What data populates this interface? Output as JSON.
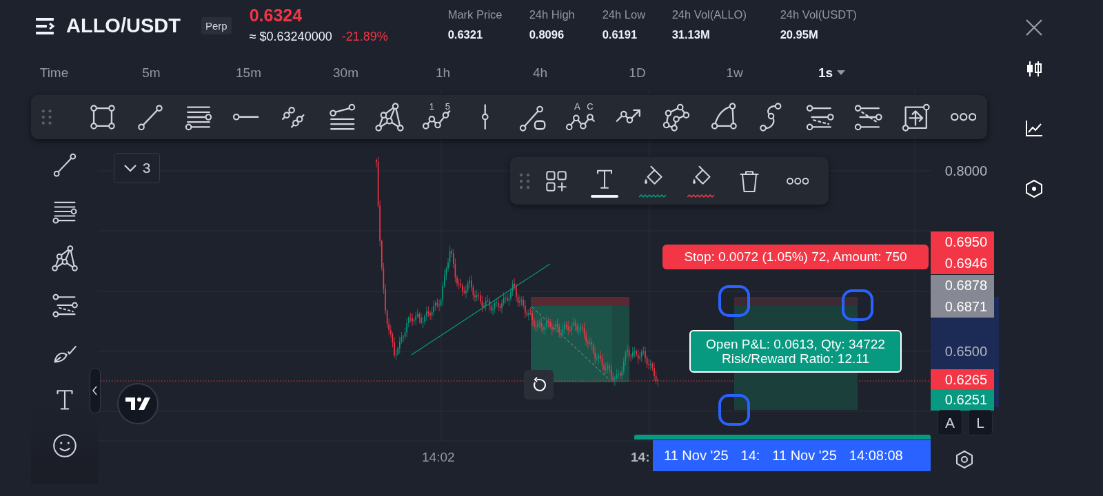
{
  "header": {
    "symbol": "ALLO/USDT",
    "badge": "Perp",
    "last_price": "0.6324",
    "approx_price": "≈ $0.63240000",
    "change": "-21.89%",
    "stats": [
      {
        "label": "Mark Price",
        "value": "0.6321"
      },
      {
        "label": "24h High",
        "value": "0.8096"
      },
      {
        "label": "24h Low",
        "value": "0.6191"
      },
      {
        "label": "24h Vol(ALLO)",
        "value": "31.13M"
      },
      {
        "label": "24h Vol(USDT)",
        "value": "20.95M"
      }
    ]
  },
  "timeframes": [
    {
      "label": "Time",
      "selected": false
    },
    {
      "label": "5m",
      "selected": false
    },
    {
      "label": "15m",
      "selected": false
    },
    {
      "label": "30m",
      "selected": false
    },
    {
      "label": "1h",
      "selected": false
    },
    {
      "label": "4h",
      "selected": false
    },
    {
      "label": "1D",
      "selected": false
    },
    {
      "label": "1w",
      "selected": false
    },
    {
      "label": "1s",
      "selected": true
    }
  ],
  "drawing_tools": [
    {
      "kind": "rectangle"
    },
    {
      "kind": "trend_line"
    },
    {
      "kind": "horizontal_lines"
    },
    {
      "kind": "horizontal_ray"
    },
    {
      "kind": "parallel_channel"
    },
    {
      "kind": "fib_lines"
    },
    {
      "kind": "xabcd_pattern"
    },
    {
      "kind": "elliott_wave",
      "marks": [
        "1",
        "5"
      ]
    },
    {
      "kind": "vertical_line"
    },
    {
      "kind": "line_with_box"
    },
    {
      "kind": "abcd_pattern",
      "marks": [
        "A",
        "C"
      ]
    },
    {
      "kind": "arrow_line"
    },
    {
      "kind": "polygon"
    },
    {
      "kind": "arc"
    },
    {
      "kind": "curve"
    },
    {
      "kind": "fib_dashed"
    },
    {
      "kind": "fib_dashed_alt"
    },
    {
      "kind": "measure_box"
    },
    {
      "kind": "more"
    }
  ],
  "side_tools": [
    {
      "kind": "trend_line"
    },
    {
      "kind": "horizontal_lines"
    },
    {
      "kind": "xabcd_pattern"
    },
    {
      "kind": "fib_dashed"
    },
    {
      "kind": "brush"
    },
    {
      "kind": "text"
    },
    {
      "kind": "emoji"
    }
  ],
  "object_toolbar": [
    {
      "kind": "add",
      "selected": false
    },
    {
      "kind": "text",
      "selected": true
    },
    {
      "kind": "fill",
      "selected": false,
      "color": "#089981"
    },
    {
      "kind": "fill",
      "selected": false,
      "color": "#f23645"
    },
    {
      "kind": "delete",
      "selected": false
    },
    {
      "kind": "more",
      "selected": false
    }
  ],
  "chart": {
    "collapsed_count": "3",
    "price_axis": [
      {
        "text": "0.8000",
        "kind": "axis"
      },
      {
        "text": "0.6950",
        "kind": "red"
      },
      {
        "text": "0.6946",
        "kind": "red"
      },
      {
        "text": "0.6878",
        "kind": "grey"
      },
      {
        "text": "0.6871",
        "kind": "grey"
      },
      {
        "text": "0.6500",
        "kind": "axis"
      },
      {
        "text": "0.6265",
        "kind": "red"
      },
      {
        "text": "0.6251",
        "kind": "green"
      }
    ],
    "time_axis": [
      {
        "text": "14:02",
        "kind": "axis"
      },
      {
        "text": "14:",
        "kind": "bold"
      }
    ],
    "stop_label": "Stop: 0.0072 (1.05%) 72, Amount: 750",
    "pnl_label": [
      "Open P&L: 0.0613, Qty: 34722",
      "Risk/Reward Ratio: 12.11"
    ],
    "crosshair_labels": [
      "11 Nov '25",
      "14:",
      "11 Nov '25",
      "14:08:08"
    ],
    "scale_buttons": [
      "A",
      "L"
    ]
  }
}
